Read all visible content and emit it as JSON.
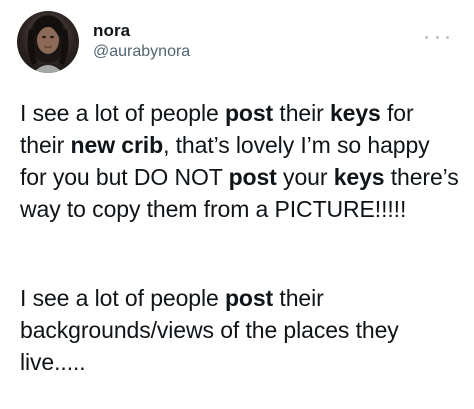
{
  "tweet": {
    "user": {
      "display_name": "nora",
      "handle": "@aurabynora",
      "avatar_icon": "profile-photo"
    },
    "more_icon": "more-options-icon",
    "paragraphs": [
      [
        {
          "text": "I see a lot of people ",
          "bold": false
        },
        {
          "text": "post",
          "bold": true
        },
        {
          "text": " their ",
          "bold": false
        },
        {
          "text": "keys",
          "bold": true
        },
        {
          "text": " for their ",
          "bold": false
        },
        {
          "text": "new crib",
          "bold": true
        },
        {
          "text": ", that’s lovely I’m so happy for you but DO NOT ",
          "bold": false
        },
        {
          "text": "post",
          "bold": true
        },
        {
          "text": " your ",
          "bold": false
        },
        {
          "text": "keys",
          "bold": true
        },
        {
          "text": " there’s way to copy them from a PICTURE!!!!!",
          "bold": false
        }
      ],
      [
        {
          "text": "I see a lot of people ",
          "bold": false
        },
        {
          "text": "post",
          "bold": true
        },
        {
          "text": " their backgrounds/views of the places they live.....",
          "bold": false
        }
      ]
    ]
  },
  "colors": {
    "text": "#0f1419",
    "secondary": "#536471",
    "more_dots": "#b7c2ca"
  }
}
